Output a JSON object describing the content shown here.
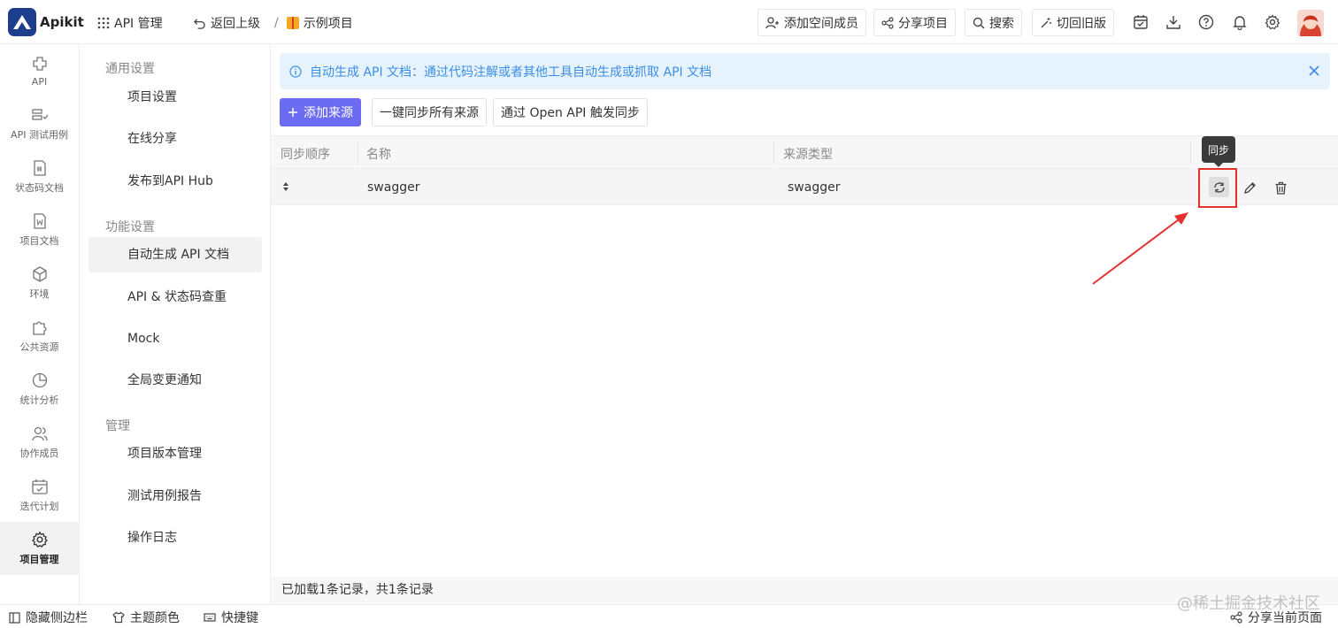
{
  "header": {
    "brand": "Apikit",
    "api_manage": "API 管理",
    "back": "返回上级",
    "separator": "/",
    "project_name": "示例项目",
    "add_member": "添加空间成员",
    "share_project": "分享项目",
    "search": "搜索",
    "switch_old": "切回旧版"
  },
  "sidebar": {
    "items": [
      {
        "label": "API",
        "icon": "api-icon"
      },
      {
        "label": "API 测试用例",
        "icon": "test-case-icon"
      },
      {
        "label": "状态码文档",
        "icon": "status-code-icon"
      },
      {
        "label": "项目文档",
        "icon": "project-doc-icon"
      },
      {
        "label": "环境",
        "icon": "environment-icon"
      },
      {
        "label": "公共资源",
        "icon": "puzzle-icon"
      },
      {
        "label": "统计分析",
        "icon": "pie-chart-icon"
      },
      {
        "label": "协作成员",
        "icon": "members-icon"
      },
      {
        "label": "迭代计划",
        "icon": "calendar-icon"
      },
      {
        "label": "项目管理",
        "icon": "gear-icon",
        "active": true
      }
    ]
  },
  "settings": {
    "groups": [
      {
        "title": "通用设置",
        "items": [
          "项目设置",
          "在线分享",
          "发布到API Hub"
        ]
      },
      {
        "title": "功能设置",
        "items": [
          "自动生成 API 文档",
          "API & 状态码查重",
          "Mock",
          "全局变更通知"
        ]
      },
      {
        "title": "管理",
        "items": [
          "项目版本管理",
          "测试用例报告",
          "操作日志"
        ]
      }
    ]
  },
  "main": {
    "alert": "自动生成 API 文档：通过代码注解或者其他工具自动生成或抓取 API 文档",
    "add_source": "添加来源",
    "sync_all": "一键同步所有来源",
    "openapi_sync": "通过 Open API 触发同步",
    "columns": [
      "同步顺序",
      "名称",
      "来源类型"
    ],
    "rows": [
      {
        "name": "swagger",
        "type": "swagger"
      }
    ],
    "tooltip": "同步",
    "footer": "已加载1条记录，共1条记录"
  },
  "bottombar": {
    "hide_sidebar": "隐藏侧边栏",
    "theme_color": "主题颜色",
    "shortcuts": "快捷键",
    "share_page": "分享当前页面",
    "watermark": "@稀土掘金技术社区"
  },
  "colors": {
    "primary": "#6c6cf2",
    "alert_bg": "#e7f3fc",
    "alert_text": "#3a8ee6",
    "highlight": "#e5322d"
  }
}
